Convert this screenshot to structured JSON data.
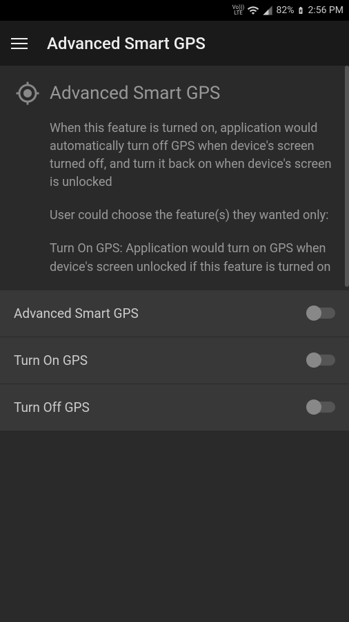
{
  "status_bar": {
    "lte_top": "Vo)))",
    "lte_bottom": "LTE",
    "battery": "82%",
    "time": "2:56 PM"
  },
  "app_bar": {
    "title": "Advanced Smart GPS"
  },
  "section": {
    "title": "Advanced Smart GPS",
    "paragraphs": [
      "When this feature is turned on, application would automatically turn off GPS when device's screen turned off, and turn it back on when device's screen is unlocked",
      "User could choose the feature(s) they wanted only:",
      "Turn On GPS: Application would turn on GPS when device's screen unlocked if this feature is turned on"
    ]
  },
  "settings": [
    {
      "label": "Advanced Smart GPS",
      "enabled": false
    },
    {
      "label": "Turn On GPS",
      "enabled": false
    },
    {
      "label": "Turn Off GPS",
      "enabled": false
    }
  ]
}
